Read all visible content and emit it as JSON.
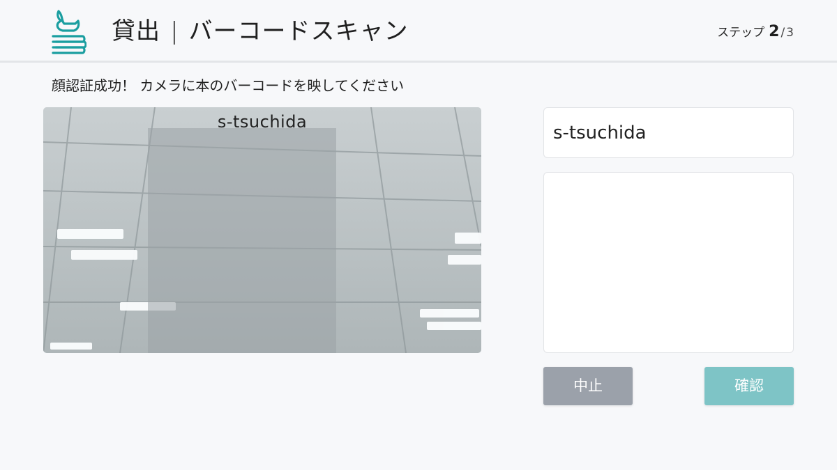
{
  "header": {
    "logo_icon": "bird-on-books-icon",
    "title_main": "貸出",
    "title_separator": "|",
    "title_sub": "バーコードスキャン",
    "step_label": "ステップ",
    "step_current": "2",
    "step_separator": "/",
    "step_total": "3"
  },
  "instruction": "顔認証成功！ カメラに本のバーコードを映してください",
  "camera": {
    "recognized_name": "s-tsuchida"
  },
  "form": {
    "user_id_value": "s-tsuchida",
    "book_list_value": ""
  },
  "buttons": {
    "cancel_label": "中止",
    "confirm_label": "確認"
  },
  "colors": {
    "accent": "#1a9ea0",
    "confirm_button": "#7ec4c6",
    "cancel_button": "#9ba1aa",
    "background": "#f7f8fa"
  }
}
